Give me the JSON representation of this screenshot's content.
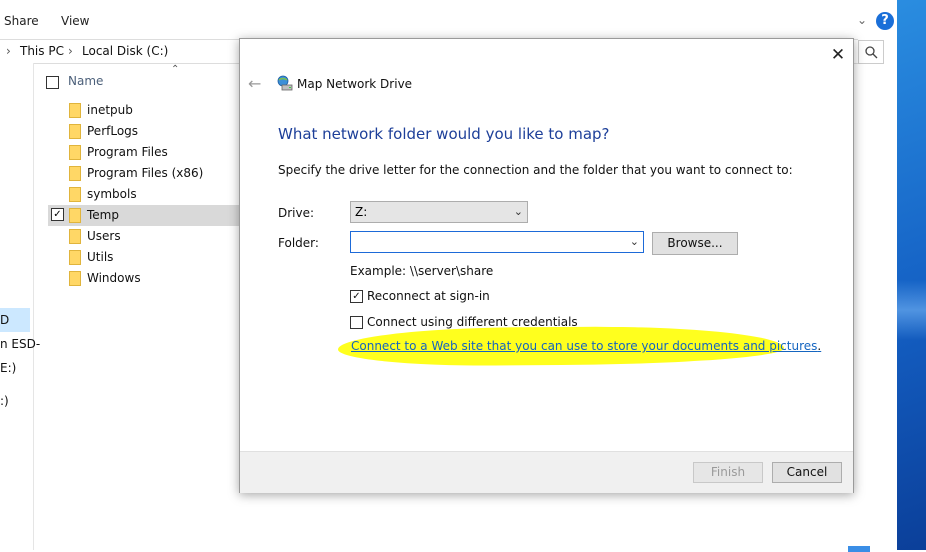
{
  "explorer": {
    "ribbon_tabs": [
      "Share",
      "View"
    ],
    "help_glyph": "?",
    "breadcrumb": [
      "This PC",
      "Local Disk (C:)"
    ],
    "column_header": "Name",
    "nav_items": [
      "D",
      "n ESD-",
      "E:)",
      ":)"
    ],
    "files": [
      {
        "name": "inetpub"
      },
      {
        "name": "PerfLogs"
      },
      {
        "name": "Program Files"
      },
      {
        "name": "Program Files (x86)"
      },
      {
        "name": "symbols"
      },
      {
        "name": "Temp",
        "selected": true,
        "checked": true
      },
      {
        "name": "Users"
      },
      {
        "name": "Utils"
      },
      {
        "name": "Windows"
      }
    ]
  },
  "dialog": {
    "title": "Map Network Drive",
    "close_glyph": "✕",
    "heading": "What network folder would you like to map?",
    "instruction": "Specify the drive letter for the connection and the folder that you want to connect to:",
    "drive_label": "Drive:",
    "drive_value": "Z:",
    "folder_label": "Folder:",
    "folder_value": "",
    "browse_label": "Browse...",
    "example_text": "Example: \\\\server\\share",
    "reconnect_label": "Reconnect at sign-in",
    "reconnect_checked": true,
    "credentials_label": "Connect using different credentials",
    "credentials_checked": false,
    "web_link_text": "Connect to a Web site that you can use to store your documents and pictures",
    "web_link_suffix": ".",
    "finish_label": "Finish",
    "cancel_label": "Cancel",
    "highlight_color": "#ffff1e"
  }
}
